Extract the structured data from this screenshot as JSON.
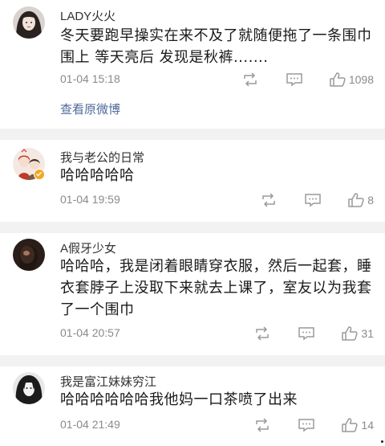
{
  "comments": [
    {
      "username": "LADY火火",
      "content": "冬天要跑早操实在来不及了就随便拖了一条围巾围上 等天亮后 发现是秋裤.......",
      "time": "01-04 15:18",
      "likes": "1098",
      "link": "查看原微博"
    },
    {
      "username": "我与老公的日常",
      "content": "哈哈哈哈哈",
      "time": "01-04 19:59",
      "likes": "8",
      "verified": true
    },
    {
      "username": "A假牙少女",
      "content": "哈哈哈，我是闭着眼睛穿衣服，然后一起套，睡衣套脖子上没取下来就去上课了，室友以为我套了一个围巾",
      "time": "01-04 20:57",
      "likes": "31"
    },
    {
      "username": "我是富江妹妹穷江",
      "content": "哈哈哈哈哈哈我他妈一口茶喷了出来",
      "time": "01-04 21:49",
      "likes": "14"
    }
  ],
  "icons": {
    "repost": "repost-icon",
    "comment": "comment-icon",
    "like": "thumbs-up-icon"
  },
  "colors": {
    "separator": "#f2f2f2",
    "link": "#4d6a99",
    "meta": "#8a8a8a",
    "verified_badge": "#f5a623"
  }
}
